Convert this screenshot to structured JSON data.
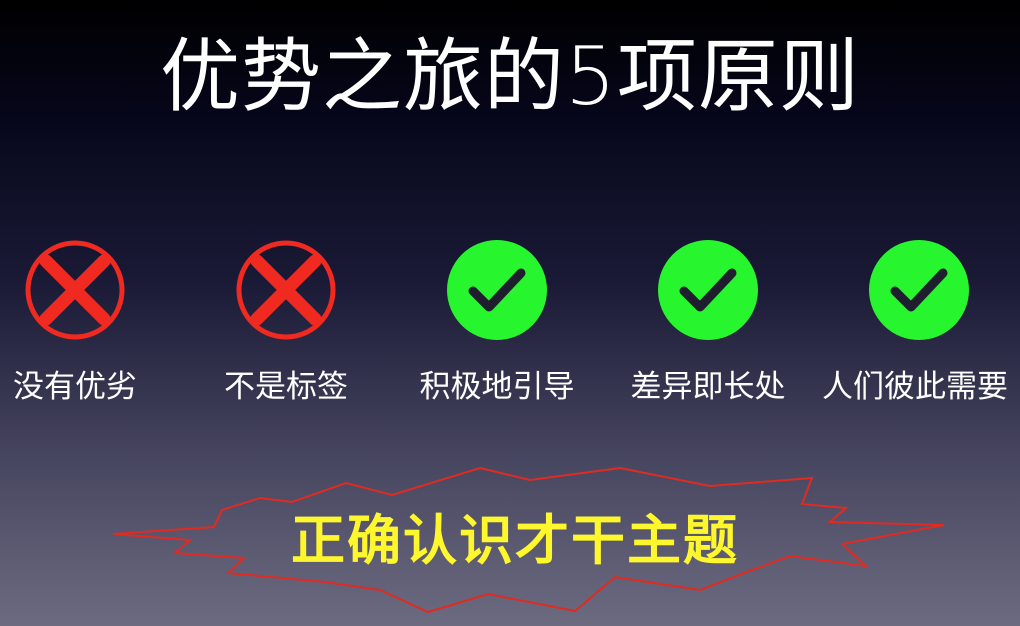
{
  "title": "优势之旅的5项原则",
  "principles": [
    {
      "label": "没有优劣",
      "icon": "cross-icon",
      "status": "wrong"
    },
    {
      "label": "不是标签",
      "icon": "cross-icon",
      "status": "wrong"
    },
    {
      "label": "积极地引导",
      "icon": "check-icon",
      "status": "right"
    },
    {
      "label": "差异即长处",
      "icon": "check-icon",
      "status": "right"
    },
    {
      "label": "人们彼此需要",
      "icon": "check-icon",
      "status": "right"
    }
  ],
  "slogan": "正确认识才干主题",
  "colors": {
    "cross_fill": "#f02a20",
    "cross_ring": "#f02a20",
    "check_fill": "#27f52e",
    "check_mark": "#1e1e2e",
    "slogan_text": "#fff72e",
    "burst_stroke": "#e12a20"
  }
}
